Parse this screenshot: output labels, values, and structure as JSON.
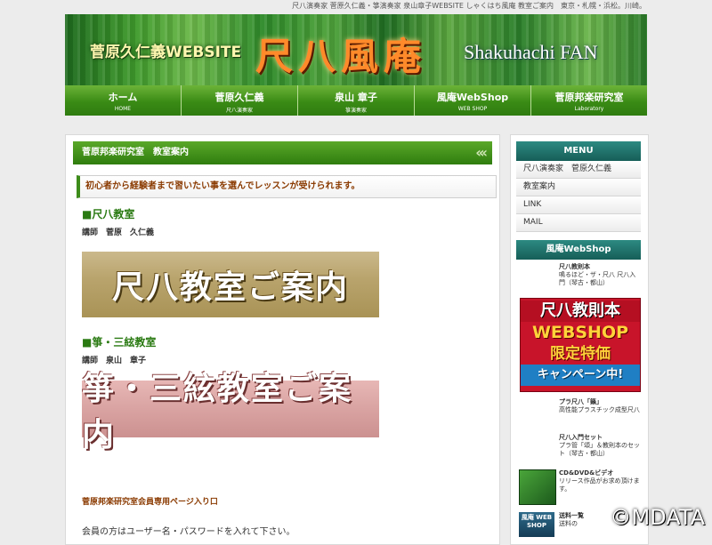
{
  "header": {
    "topline": "尺八演奏家 菅原久仁義・箏演奏家 泉山章子WEBSITE しゃくはち風庵 教室ご案内　東京・札幌・浜松。川崎。",
    "banner_left": "菅原久仁義WEBSITE",
    "banner_center": "尺八風庵",
    "banner_right": "Shakuhachi FAN"
  },
  "nav": [
    {
      "label": "ホーム",
      "sub": "HOME"
    },
    {
      "label": "菅原久仁義",
      "sub": "尺八演奏家"
    },
    {
      "label": "泉山 章子",
      "sub": "箏演奏家"
    },
    {
      "label": "風庵WebShop",
      "sub": "WEB SHOP"
    },
    {
      "label": "菅原邦楽研究室",
      "sub": "Laboratory"
    }
  ],
  "main": {
    "heading": "菅原邦楽研究室　教室案内",
    "heading_arrows": "‹‹‹",
    "intro": "初心者から経験者まで習いたい事を選んでレッスンが受けられます。",
    "shakuhachi_title": "■尺八教室",
    "shakuhachi_teacher": "講師　菅原　久仁義",
    "shakuhachi_banner": "尺八教室ご案内",
    "koto_title": "■箏・三絃教室",
    "koto_teacher": "講師　泉山　章子",
    "koto_banner": "箏・三絃教室ご案内",
    "member_link": "菅原邦楽研究室会員専用ページ入り口",
    "member_note": "会員の方はユーザー名・パスワードを入れて下さい。"
  },
  "sidebar": {
    "menu_title": "MENU",
    "menu_items": [
      "尺八演奏家　菅原久仁義",
      "教室案内",
      "LINK",
      "MAIL"
    ],
    "shop_title": "風庵WebShop",
    "shop_items": [
      {
        "title": "尺八教則本",
        "desc": "鳴るほど・ザ・尺八 尺八入門（琴古・都山）"
      },
      {
        "title": "プラ尺八「籟」",
        "desc": "高性能プラスチック成型尺八"
      },
      {
        "title": "尺八入門セット",
        "desc": "プラ管「頌」＆教則本のセット（琴古・都山）"
      },
      {
        "title": "CD&DVD&ビデオ",
        "desc": "リリース作品がお求め頂けます。"
      },
      {
        "title": "送料一覧",
        "desc": "送料の"
      }
    ],
    "campaign": {
      "line1": "尺八教則本",
      "line2": "WEBSHOP",
      "line3": "限定特価",
      "line4": "キャンペーン中!"
    },
    "thumb_label": "風庵 WEB SHOP"
  },
  "watermark": "©MDATA"
}
